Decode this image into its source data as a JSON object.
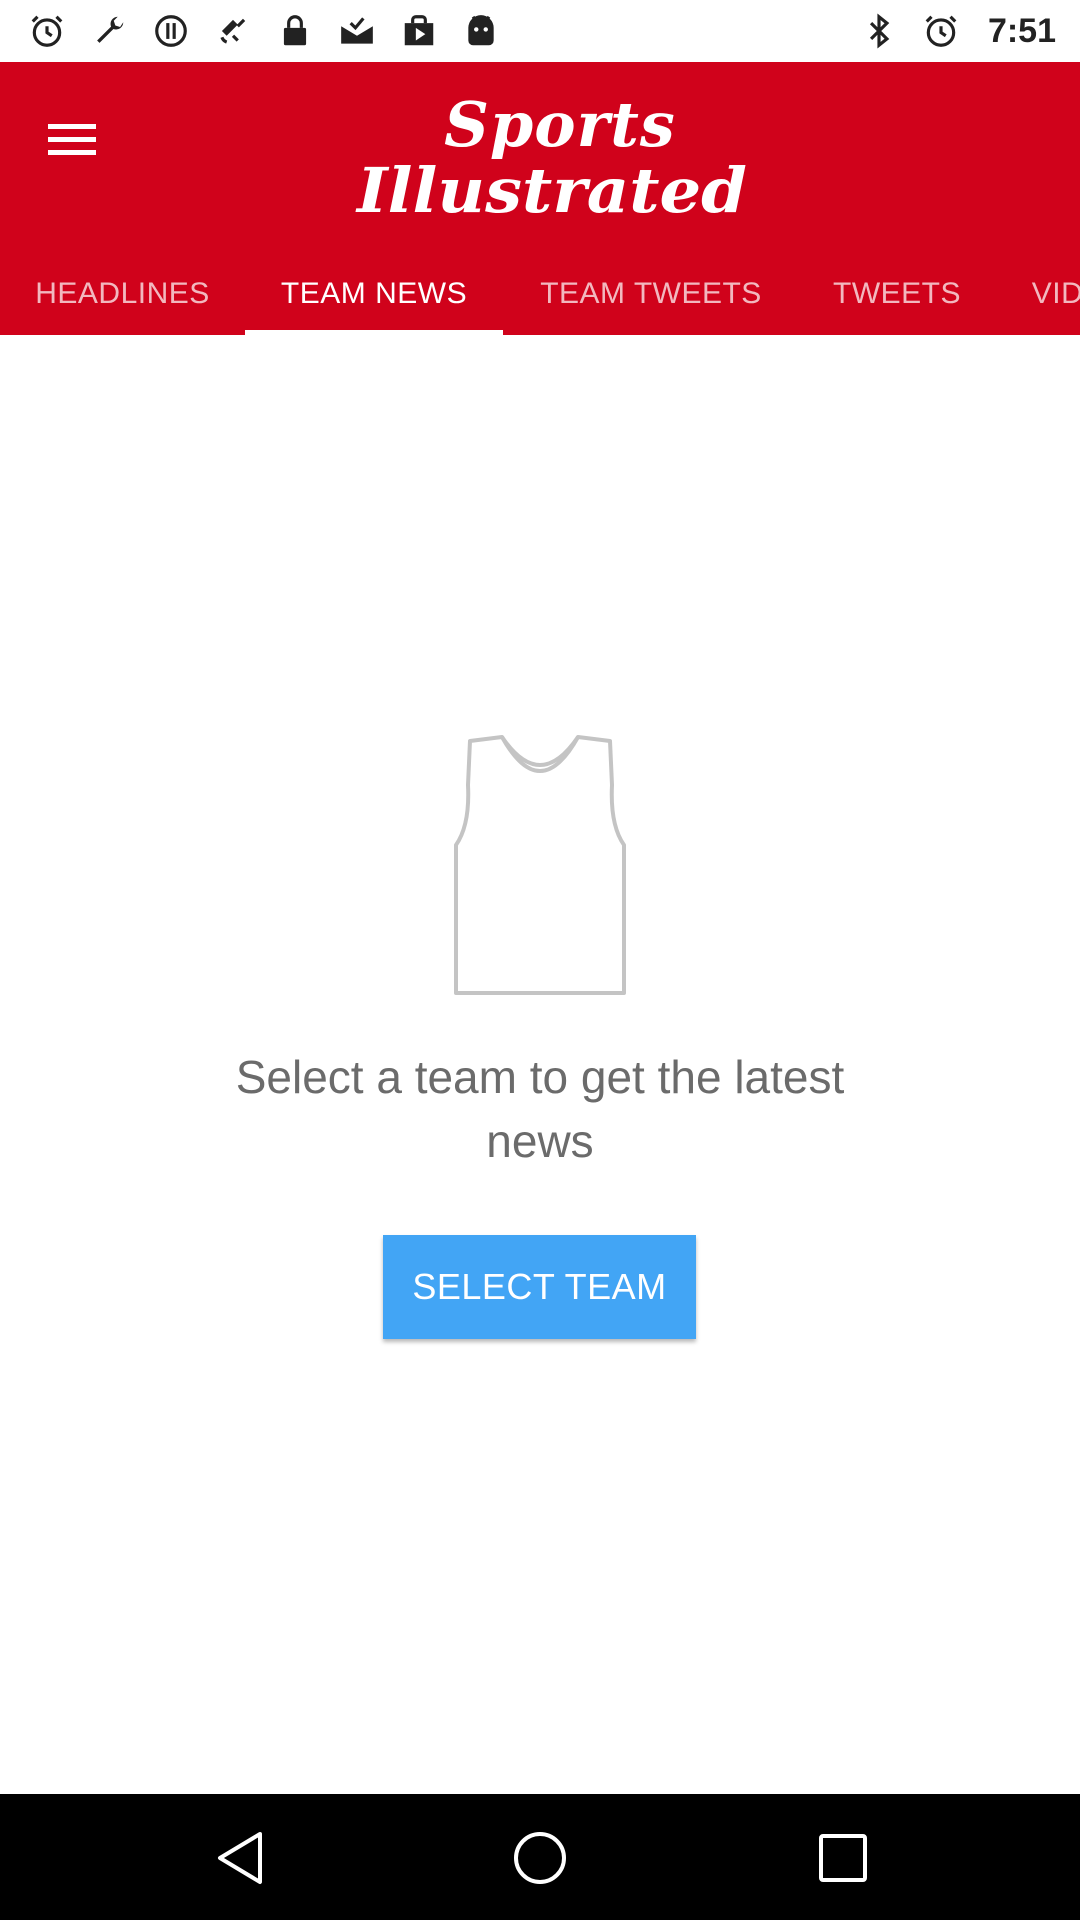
{
  "status_bar": {
    "time": "7:51",
    "left_icons": [
      "alarm-icon",
      "wrench-icon",
      "record-icon",
      "satellite-icon",
      "lock-icon",
      "mail-check-icon",
      "play-store-icon",
      "android-icon"
    ],
    "right_icons": [
      "bluetooth-icon",
      "alarm-icon"
    ]
  },
  "app_bar": {
    "logo_line1": "Sports",
    "logo_line2": "Illustrated",
    "brand_color": "#d0021b"
  },
  "tabs": [
    {
      "label": "HEADLINES",
      "active": false
    },
    {
      "label": "TEAM NEWS",
      "active": true
    },
    {
      "label": "TEAM TWEETS",
      "active": false
    },
    {
      "label": "TWEETS",
      "active": false
    },
    {
      "label": "VID",
      "active": false
    }
  ],
  "empty_state": {
    "icon": "jersey-icon",
    "message": "Select a team to get the latest news",
    "button_label": "SELECT TEAM",
    "button_color": "#42a5f5"
  },
  "nav_bar": {
    "buttons": [
      "back-icon",
      "home-icon",
      "recents-icon"
    ]
  }
}
